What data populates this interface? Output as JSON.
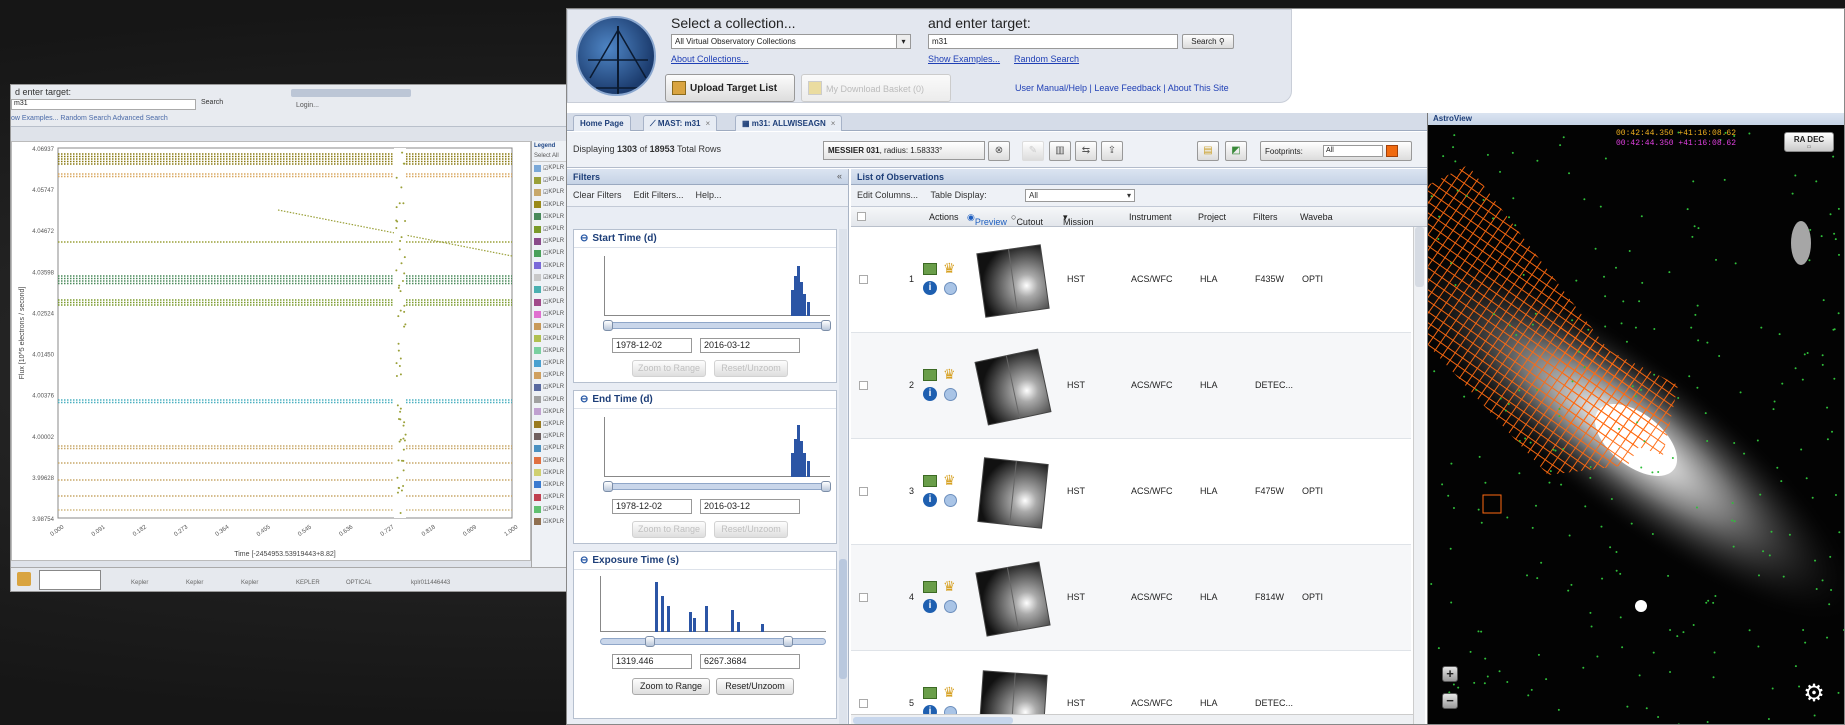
{
  "back_window": {
    "header": {
      "target_label": "d enter target:",
      "target_value": "m31",
      "search_label": "Search",
      "links": "ow Examples... Random Search  Advanced Search",
      "login": "Login..."
    },
    "plot": {
      "ylabel": "Flux [10^5 electrons / second]",
      "xlabel": "Time [-2454953.53919443+8.82]",
      "yticks": [
        "4.06937",
        "4.05747",
        "4.04672",
        "4.03598",
        "4.02524",
        "4.01450",
        "4.00376",
        "4.00002",
        "3.99628",
        "3.98754"
      ],
      "xticks": [
        "0.000",
        "0.091",
        "0.182",
        "0.273",
        "0.364",
        "0.455",
        "0.545",
        "0.636",
        "0.727",
        "0.818",
        "0.909",
        "1.000"
      ]
    },
    "legend": {
      "title": "Legend",
      "select_all": "Select All",
      "row_label": "KPLR",
      "colors": [
        "#7aa8d8",
        "#9aa038",
        "#c8a86a",
        "#9a8a1a",
        "#4a8a5a",
        "#7a9a2a",
        "#8a4a8a",
        "#4aa05a",
        "#7a6ad8",
        "#c8c8c8",
        "#4ab0b0",
        "#a04a8a",
        "#e070d0",
        "#c89a5a",
        "#b0c050",
        "#7ad0a0",
        "#4aa0d0",
        "#d0a060",
        "#5a6aa0",
        "#a0a0a0",
        "#c0a0d0",
        "#9a7a20",
        "#706060",
        "#4a90c0",
        "#e07040",
        "#d0d070",
        "#3a7ad0",
        "#c04050",
        "#60c070",
        "#907050"
      ]
    },
    "bottom_row": [
      "Kepler",
      "Kepler",
      "Kepler",
      "KEPLER",
      "OPTICAL",
      "kplr011446443"
    ]
  },
  "header": {
    "collection_label": "Select a collection...",
    "collection_value": "All Virtual Observatory Collections",
    "about_collections": "About Collections...",
    "target_label": "and enter target:",
    "target_value": "m31",
    "search_button": "Search",
    "show_examples": "Show Examples...",
    "random_search": "Random Search",
    "upload_button": "Upload Target List",
    "download_button": "My Download Basket (0)",
    "footer_links": "User Manual/Help | Leave Feedback | About This Site"
  },
  "tabs": [
    {
      "label": "Home Page",
      "closable": false
    },
    {
      "label": "MAST: m31",
      "closable": true
    },
    {
      "label": "m31: ALLWISEAGN",
      "closable": true
    }
  ],
  "toolbar": {
    "displaying_prefix": "Displaying ",
    "displaying_shown": "1303",
    "displaying_mid": " of ",
    "displaying_total": "18953",
    "displaying_suffix": " Total Rows",
    "target_name": "MESSIER 031",
    "target_radius": ", radius: 1.58333°",
    "footprints_label": "Footprints:",
    "footprints_value": "All",
    "footprint_color": "#f06a10"
  },
  "filters": {
    "title": "Filters",
    "clear": "Clear Filters",
    "edit": "Edit Filters...",
    "help": "Help...",
    "zoom": "Zoom to Range",
    "reset": "Reset/Unzoom",
    "sections": [
      {
        "title": "Start Time (d)",
        "min": "1978-12-02",
        "max": "2016-03-12"
      },
      {
        "title": "End Time (d)",
        "min": "1978-12-02",
        "max": "2016-03-12"
      },
      {
        "title": "Exposure Time (s)",
        "min": "1319.446",
        "max": "6267.3684"
      }
    ]
  },
  "observations": {
    "title": "List of Observations",
    "edit_columns": "Edit Columns...",
    "table_display_label": "Table Display:",
    "table_display_value": "All",
    "columns": [
      "Actions",
      "Preview",
      "Cutout",
      "Mission",
      "Instrument",
      "Project",
      "Filters",
      "Waveba"
    ],
    "rows": [
      {
        "num": "1",
        "mission": "HST",
        "instrument": "ACS/WFC",
        "project": "HLA",
        "filters": "F435W",
        "waveband": "OPTI"
      },
      {
        "num": "2",
        "mission": "HST",
        "instrument": "ACS/WFC",
        "project": "HLA",
        "filters": "DETEC...",
        "waveband": ""
      },
      {
        "num": "3",
        "mission": "HST",
        "instrument": "ACS/WFC",
        "project": "HLA",
        "filters": "F475W",
        "waveband": "OPTI"
      },
      {
        "num": "4",
        "mission": "HST",
        "instrument": "ACS/WFC",
        "project": "HLA",
        "filters": "F814W",
        "waveband": "OPTI"
      },
      {
        "num": "5",
        "mission": "HST",
        "instrument": "ACS/WFC",
        "project": "HLA",
        "filters": "DETEC...",
        "waveband": ""
      }
    ]
  },
  "astroview": {
    "title": "AstroView",
    "coord1": "00:42:44.350 +41:16:08.62",
    "coord2": "00:42:44.350 +41:16:08.62",
    "coord1_color": "#f0b020",
    "coord2_color": "#e040e0",
    "radec_button": "RA DEC",
    "zoom_in": "+",
    "zoom_out": "−"
  }
}
